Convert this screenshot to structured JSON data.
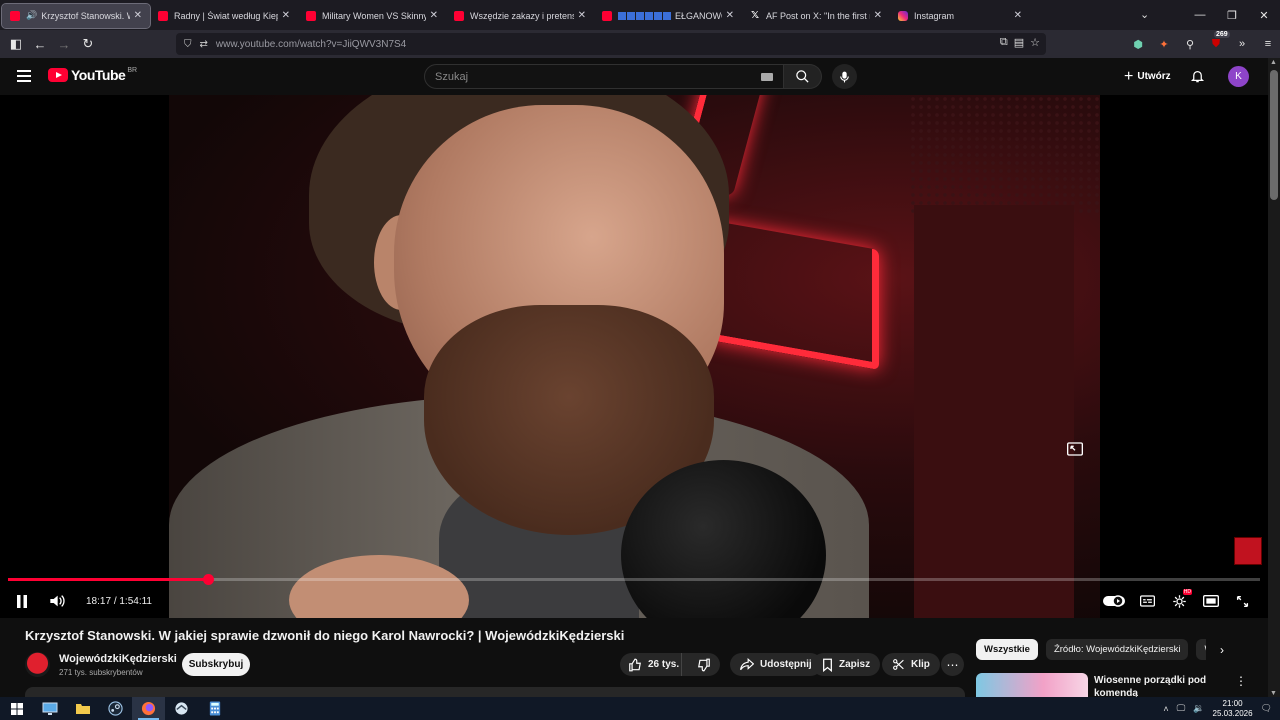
{
  "browser": {
    "tabs": [
      {
        "label": "Krzysztof Stanowski. W jaki",
        "icon": "youtube-icon",
        "active": true,
        "playing": true
      },
      {
        "label": "Radny | Świat według Kiepskich",
        "icon": "youtube-icon"
      },
      {
        "label": "Military Women VS Skinny Joes",
        "icon": "youtube-icon"
      },
      {
        "label": "Wszędzie zakazy i pretensje! Lu",
        "icon": "youtube-icon"
      },
      {
        "label": "EŁGANOWO: D",
        "icon": "youtube-icon",
        "flags": true
      },
      {
        "label": "AF Post on X: \"In the first nine n",
        "icon": "x-icon"
      },
      {
        "label": "Instagram",
        "icon": "instagram-icon"
      }
    ],
    "close_glyph": "✕",
    "url": "www.youtube.com/watch?v=JiiQWV3N7S4",
    "extensions_badge": "269"
  },
  "youtube": {
    "logo_text": "YouTube",
    "country_code": "BR",
    "search_placeholder": "Szukaj",
    "create_label": "Utwórz",
    "avatar_letter": "K"
  },
  "player": {
    "current_time": "18:17",
    "duration": "1:54:11",
    "progress": 0.16,
    "hd_badge": "HD"
  },
  "video": {
    "title": "Krzysztof Stanowski. W jakiej sprawie dzwonił do niego Karol Nawrocki? | WojewódzkiKędzierski",
    "channel_name": "WojewódzkiKędzierski",
    "subscribers": "271 tys. subskrybentów",
    "subscribe_label": "Subskrybuj",
    "likes": "26 tys.",
    "share_label": "Udostępnij",
    "save_label": "Zapisz",
    "clip_label": "Klip"
  },
  "sidebar": {
    "chips": [
      "Wszystkie",
      "Źródło: WojewódzkiKędzierski",
      "Wi"
    ],
    "recommendation_title": "Wiosenne porządki pod komendą"
  },
  "taskbar": {
    "time": "21:00",
    "date": "25.03.2026"
  },
  "colors": {
    "yt_red": "#ff0033",
    "bg": "#0f0f0f",
    "avatar": "#8e44c9"
  }
}
